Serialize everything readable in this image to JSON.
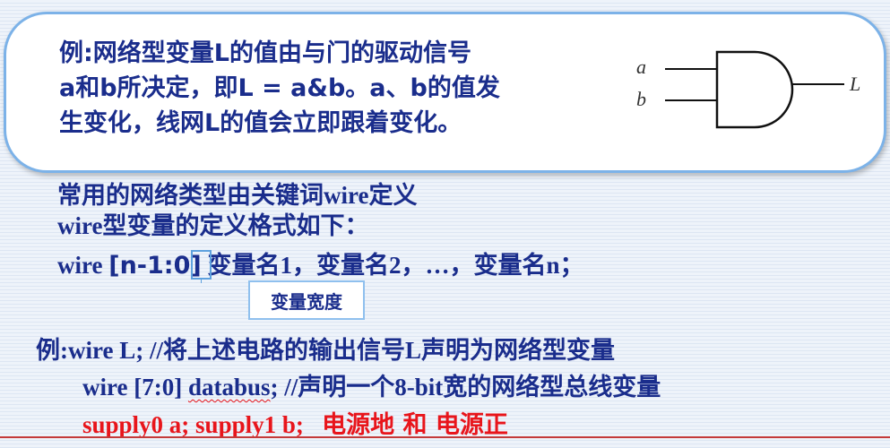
{
  "callout": {
    "line1": "例:网络型变量L的值由与门的驱动信号",
    "line2": "a和b所决定，即L = a&b。a、b的值发",
    "line3": "生变化，线网L的值会立即跟着变化。"
  },
  "gate": {
    "input_a": "a",
    "input_b": "b",
    "output": "L"
  },
  "definition": {
    "line1": "常用的网络类型由关键词wire定义",
    "line2": "wire型变量的定义格式如下：",
    "line3_kw": "wire ",
    "line3_range": "[n-1:0]",
    "line3_rest": " 变量名1，变量名2，…，变量名n；",
    "width_label": "变量宽度"
  },
  "examples": {
    "ex1": "例:wire L;  //将上述电路的输出信号L声明为网络型变量",
    "ex2_pre": "wire [7:0] ",
    "ex2_squiggle": "databus",
    "ex2_post": "; //声明一个8-bit宽的网络型总线变量",
    "ex3_code": "supply0  a; supply1 b;",
    "ex3_note": "电源地 和 电源正"
  },
  "colors": {
    "text": "#1a2d8c",
    "highlight": "#e8151b",
    "callout_border": "#7cb2e8"
  }
}
